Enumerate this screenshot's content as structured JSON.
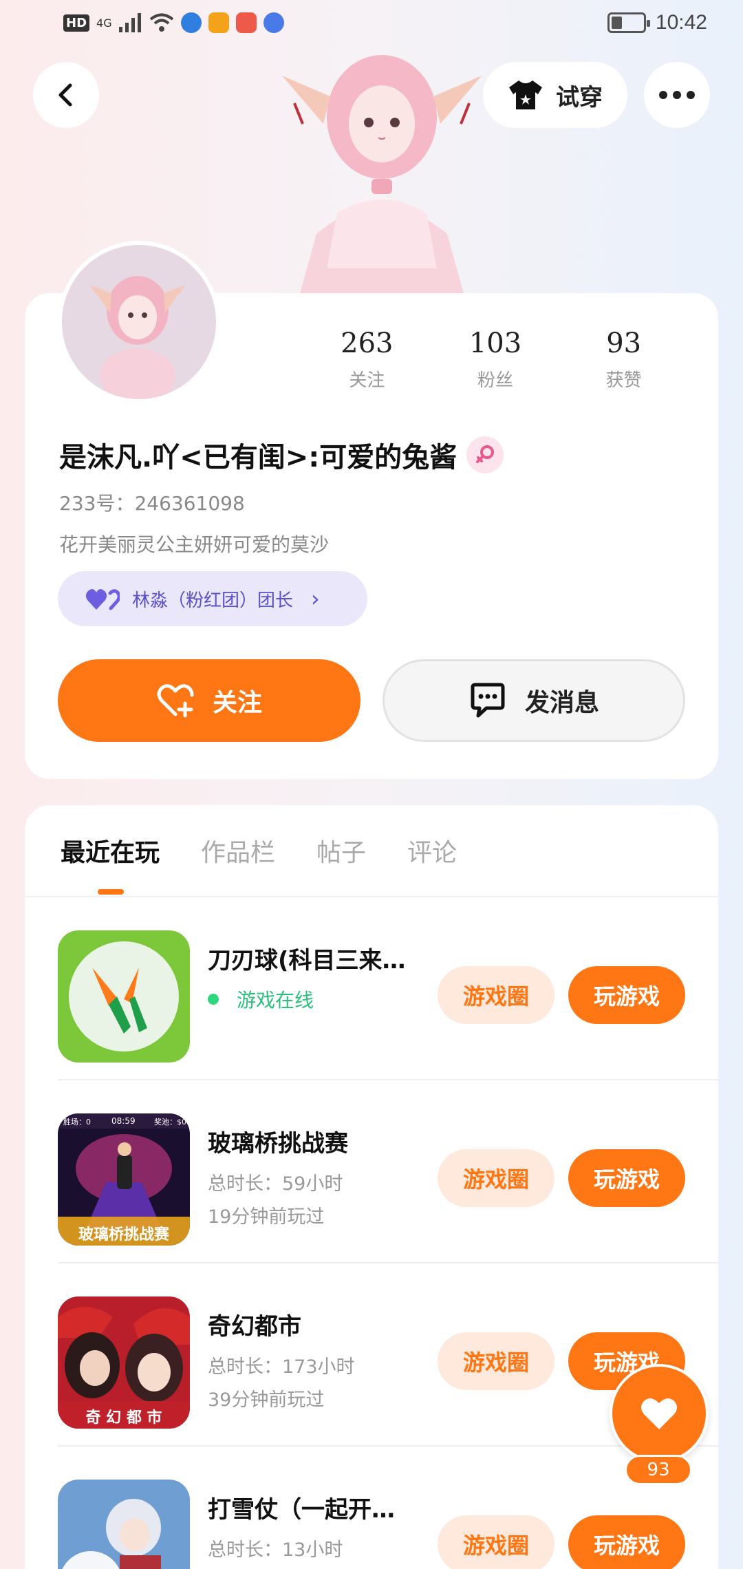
{
  "status_bar": {
    "hd": "HD",
    "network": "4G",
    "time": "10:42",
    "battery_level": 0.35,
    "icons": [
      "signal-icon",
      "wifi-icon",
      "browser-app-icon",
      "video-app-icon",
      "shop-app-icon",
      "music-app-icon"
    ]
  },
  "top_nav": {
    "back_icon": "chevron-left-icon",
    "tryon_label": "试穿",
    "tryon_icon": "tshirt-icon",
    "more_icon": "more-dots-icon"
  },
  "profile": {
    "stats": [
      {
        "value": "263",
        "label": "关注"
      },
      {
        "value": "103",
        "label": "粉丝"
      },
      {
        "value": "93",
        "label": "获赞"
      }
    ],
    "nickname": "是沫凡.吖<已有闺>:可爱的兔酱",
    "gender_icon": "female-icon",
    "uid": "233号：246361098",
    "bio": "花开美丽灵公主妍妍可爱的莫沙",
    "fan_badge": "林淼（粉红团）团长",
    "follow_label": "关注",
    "message_label": "发消息"
  },
  "tabs": [
    "最近在玩",
    "作品栏",
    "帖子",
    "评论"
  ],
  "games": [
    {
      "title": "刀刃球(科目三来…",
      "line1": "游戏在线",
      "line2": "",
      "online": true,
      "circle_label": "游戏圈",
      "play_label": "玩游戏"
    },
    {
      "title": "玻璃桥挑战赛",
      "line1": "总时长：59小时",
      "line2": "19分钟前玩过",
      "online": false,
      "circle_label": "游戏圈",
      "play_label": "玩游戏",
      "thumb_text": "玻璃桥挑战赛",
      "thumb_hud": [
        "胜场：0",
        "08:59",
        "奖池：$0"
      ]
    },
    {
      "title": "奇幻都市",
      "line1": "总时长：173小时",
      "line2": "39分钟前玩过",
      "online": false,
      "circle_label": "游戏圈",
      "play_label": "玩游戏",
      "thumb_text": "奇 幻 都 市"
    },
    {
      "title": "打雪仗（一起开…",
      "line1": "总时长：13小时",
      "line2": "",
      "online": false,
      "circle_label": "游戏圈",
      "play_label": "玩游戏"
    }
  ],
  "like_fab": {
    "count": "93",
    "icon": "heart-icon"
  },
  "colors": {
    "accent": "#ff7614",
    "online": "#2dd67f",
    "badge_text": "#5a50c8"
  }
}
